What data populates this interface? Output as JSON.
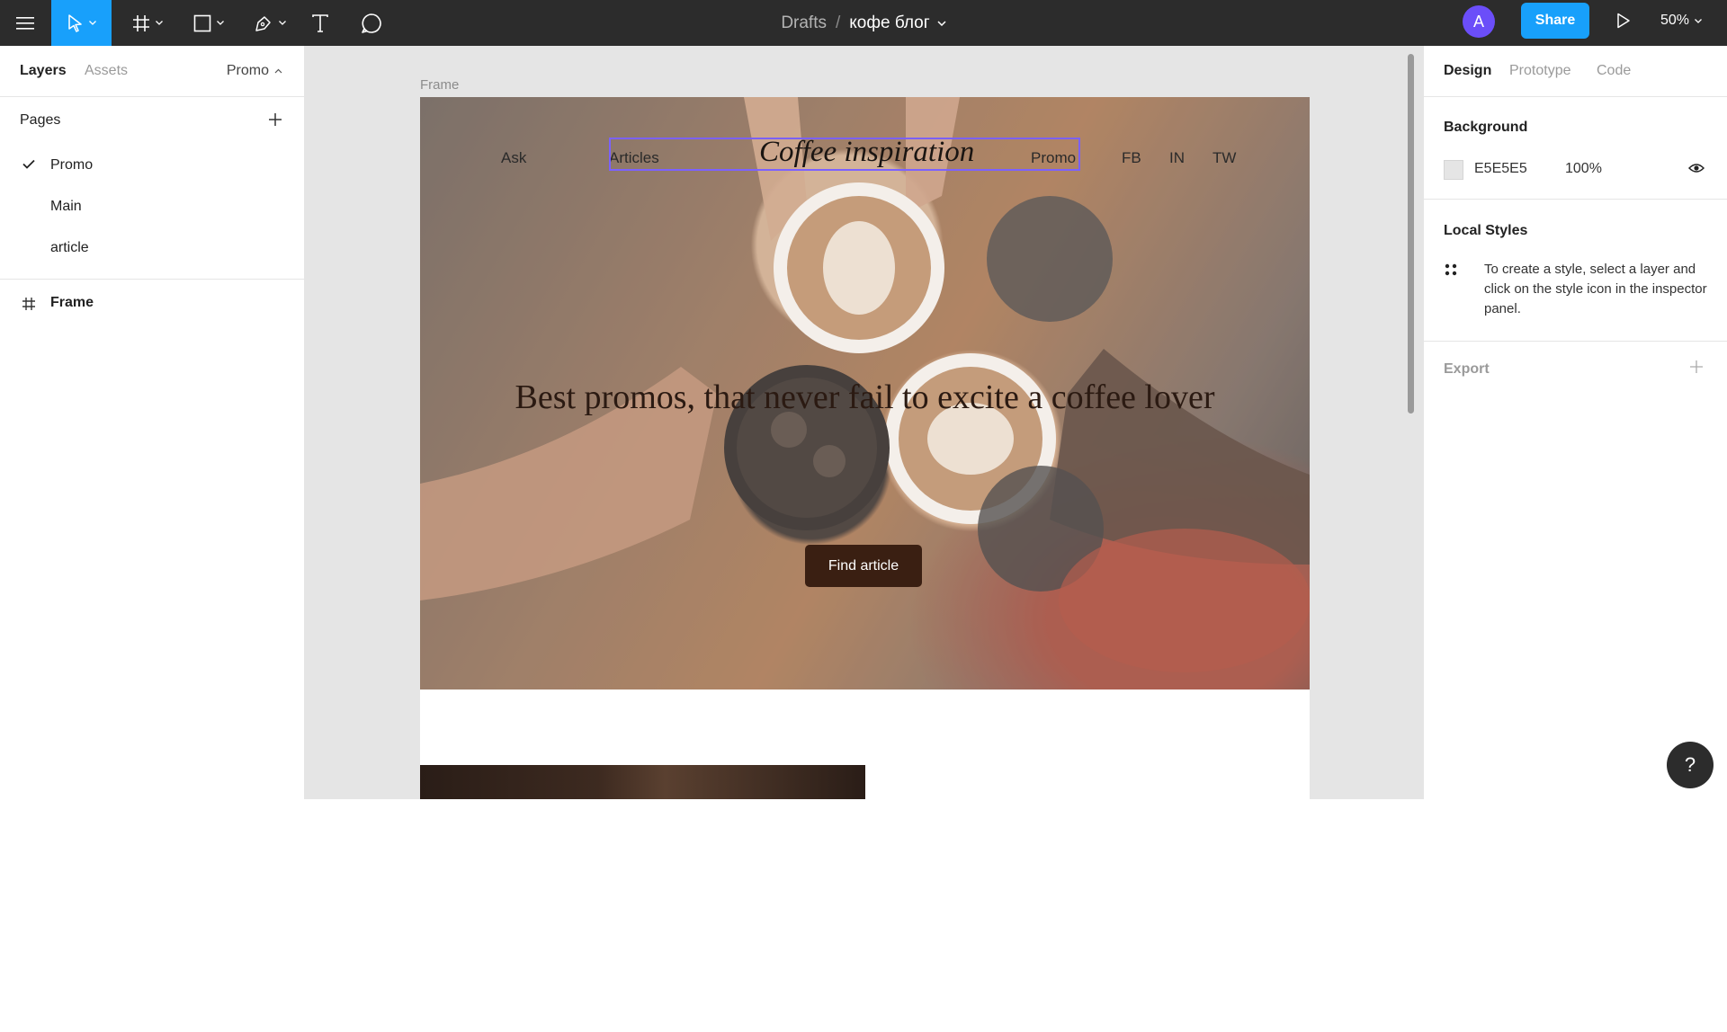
{
  "toolbar": {
    "breadcrumb": "Drafts",
    "separator": "/",
    "file_name": "кофе блог",
    "avatar_initial": "A",
    "share_label": "Share",
    "zoom": "50%",
    "accent": "#18a0fb"
  },
  "left_panel": {
    "tabs": [
      "Layers",
      "Assets"
    ],
    "current_page": "Promo",
    "pages_title": "Pages",
    "pages": [
      {
        "label": "Promo",
        "selected": true
      },
      {
        "label": "Main",
        "selected": false
      },
      {
        "label": "article",
        "selected": false
      }
    ],
    "layers": [
      {
        "label": "Frame",
        "icon": "frame-icon"
      }
    ]
  },
  "canvas": {
    "frame_label": "Frame",
    "background": "#e5e5e5",
    "hero": {
      "nav": [
        "Ask",
        "Articles",
        "Promo",
        "FB",
        "IN",
        "TW"
      ],
      "brand": "Coffee inspiration",
      "headline": "Best promos, that never fail to excite a coffee lover",
      "cta": "Find article",
      "selection_color": "#7b61ff"
    }
  },
  "right_panel": {
    "tabs": [
      "Design",
      "Prototype",
      "Code"
    ],
    "background": {
      "title": "Background",
      "hex": "E5E5E5",
      "opacity": "100%"
    },
    "local_styles": {
      "title": "Local Styles",
      "hint": "To create a style, select a layer and click on the style icon in the inspector panel."
    },
    "export": {
      "title": "Export"
    }
  },
  "help_label": "?"
}
